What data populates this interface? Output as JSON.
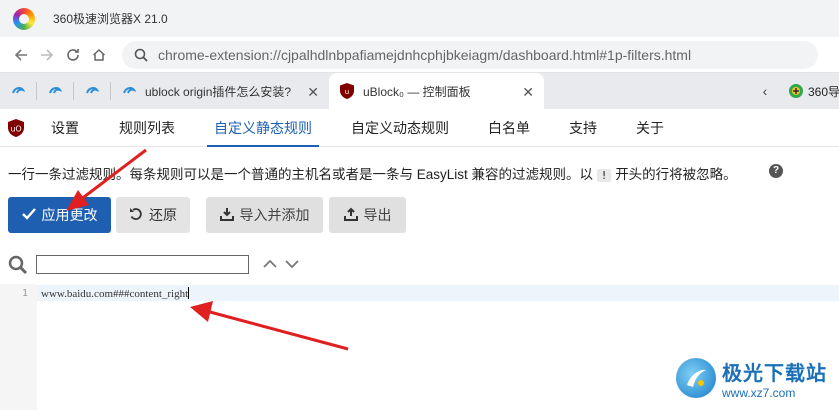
{
  "browser": {
    "title": "360极速浏览器X 21.0",
    "url": "chrome-extension://cjpalhdlnbpafiamejdnhcphjbkeiagm/dashboard.html#1p-filters.html"
  },
  "tabs": [
    {
      "label": "ublock origin插件怎么安装?"
    },
    {
      "label": "uBlock₀ — 控制面板"
    },
    {
      "label": "360导"
    }
  ],
  "ublock": {
    "nav": [
      "设置",
      "规则列表",
      "自定义静态规则",
      "自定义动态规则",
      "白名单",
      "支持",
      "关于"
    ],
    "active_tab": "自定义静态规则",
    "description_before": "一行一条过滤规则。每条规则可以是一个普通的主机名或者是一条与 EasyList 兼容的过滤规则。以",
    "description_mark": "!",
    "description_after": "开头的行将被忽略。",
    "buttons": {
      "apply": "应用更改",
      "revert": "还原",
      "import": "导入并添加",
      "export": "导出"
    },
    "search_value": "",
    "editor": {
      "line_number": "1",
      "line_text": "www.baidu.com###content_right"
    }
  },
  "watermark": {
    "cn": "极光下载站",
    "en": "www.xz7.com"
  },
  "colors": {
    "accent": "#1f5fb2",
    "annotation_arrow": "#e02020"
  }
}
